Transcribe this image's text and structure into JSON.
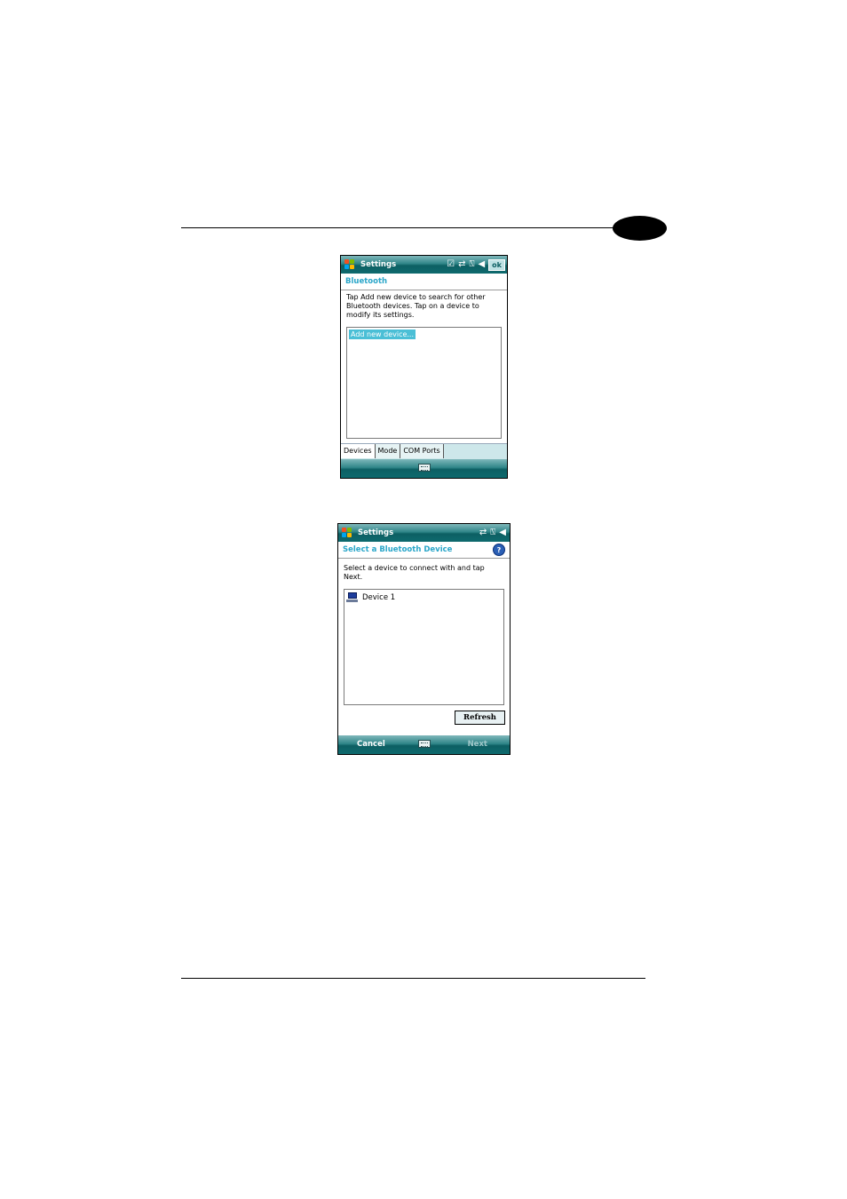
{
  "screen1": {
    "title": "Settings",
    "status_icons": [
      "checkbox-icon",
      "sync-arrows-icon",
      "signal-off-icon",
      "volume-icon"
    ],
    "ok_label": "ok",
    "header": "Bluetooth",
    "instructions": "Tap Add new device to search for other Bluetooth devices. Tap on a device to modify its settings.",
    "list_items": [
      "Add new device..."
    ],
    "tabs": [
      "Devices",
      "Mode",
      "COM Ports"
    ],
    "active_tab": "Devices"
  },
  "screen2": {
    "title": "Settings",
    "status_icons": [
      "sync-arrows-icon",
      "signal-off-icon",
      "volume-icon"
    ],
    "header": "Select a Bluetooth Device",
    "help_label": "?",
    "instructions": "Select a device to connect with and tap Next.",
    "devices": [
      "Device 1"
    ],
    "refresh_label": "Refresh",
    "menu_left": "Cancel",
    "menu_right": "Next"
  }
}
